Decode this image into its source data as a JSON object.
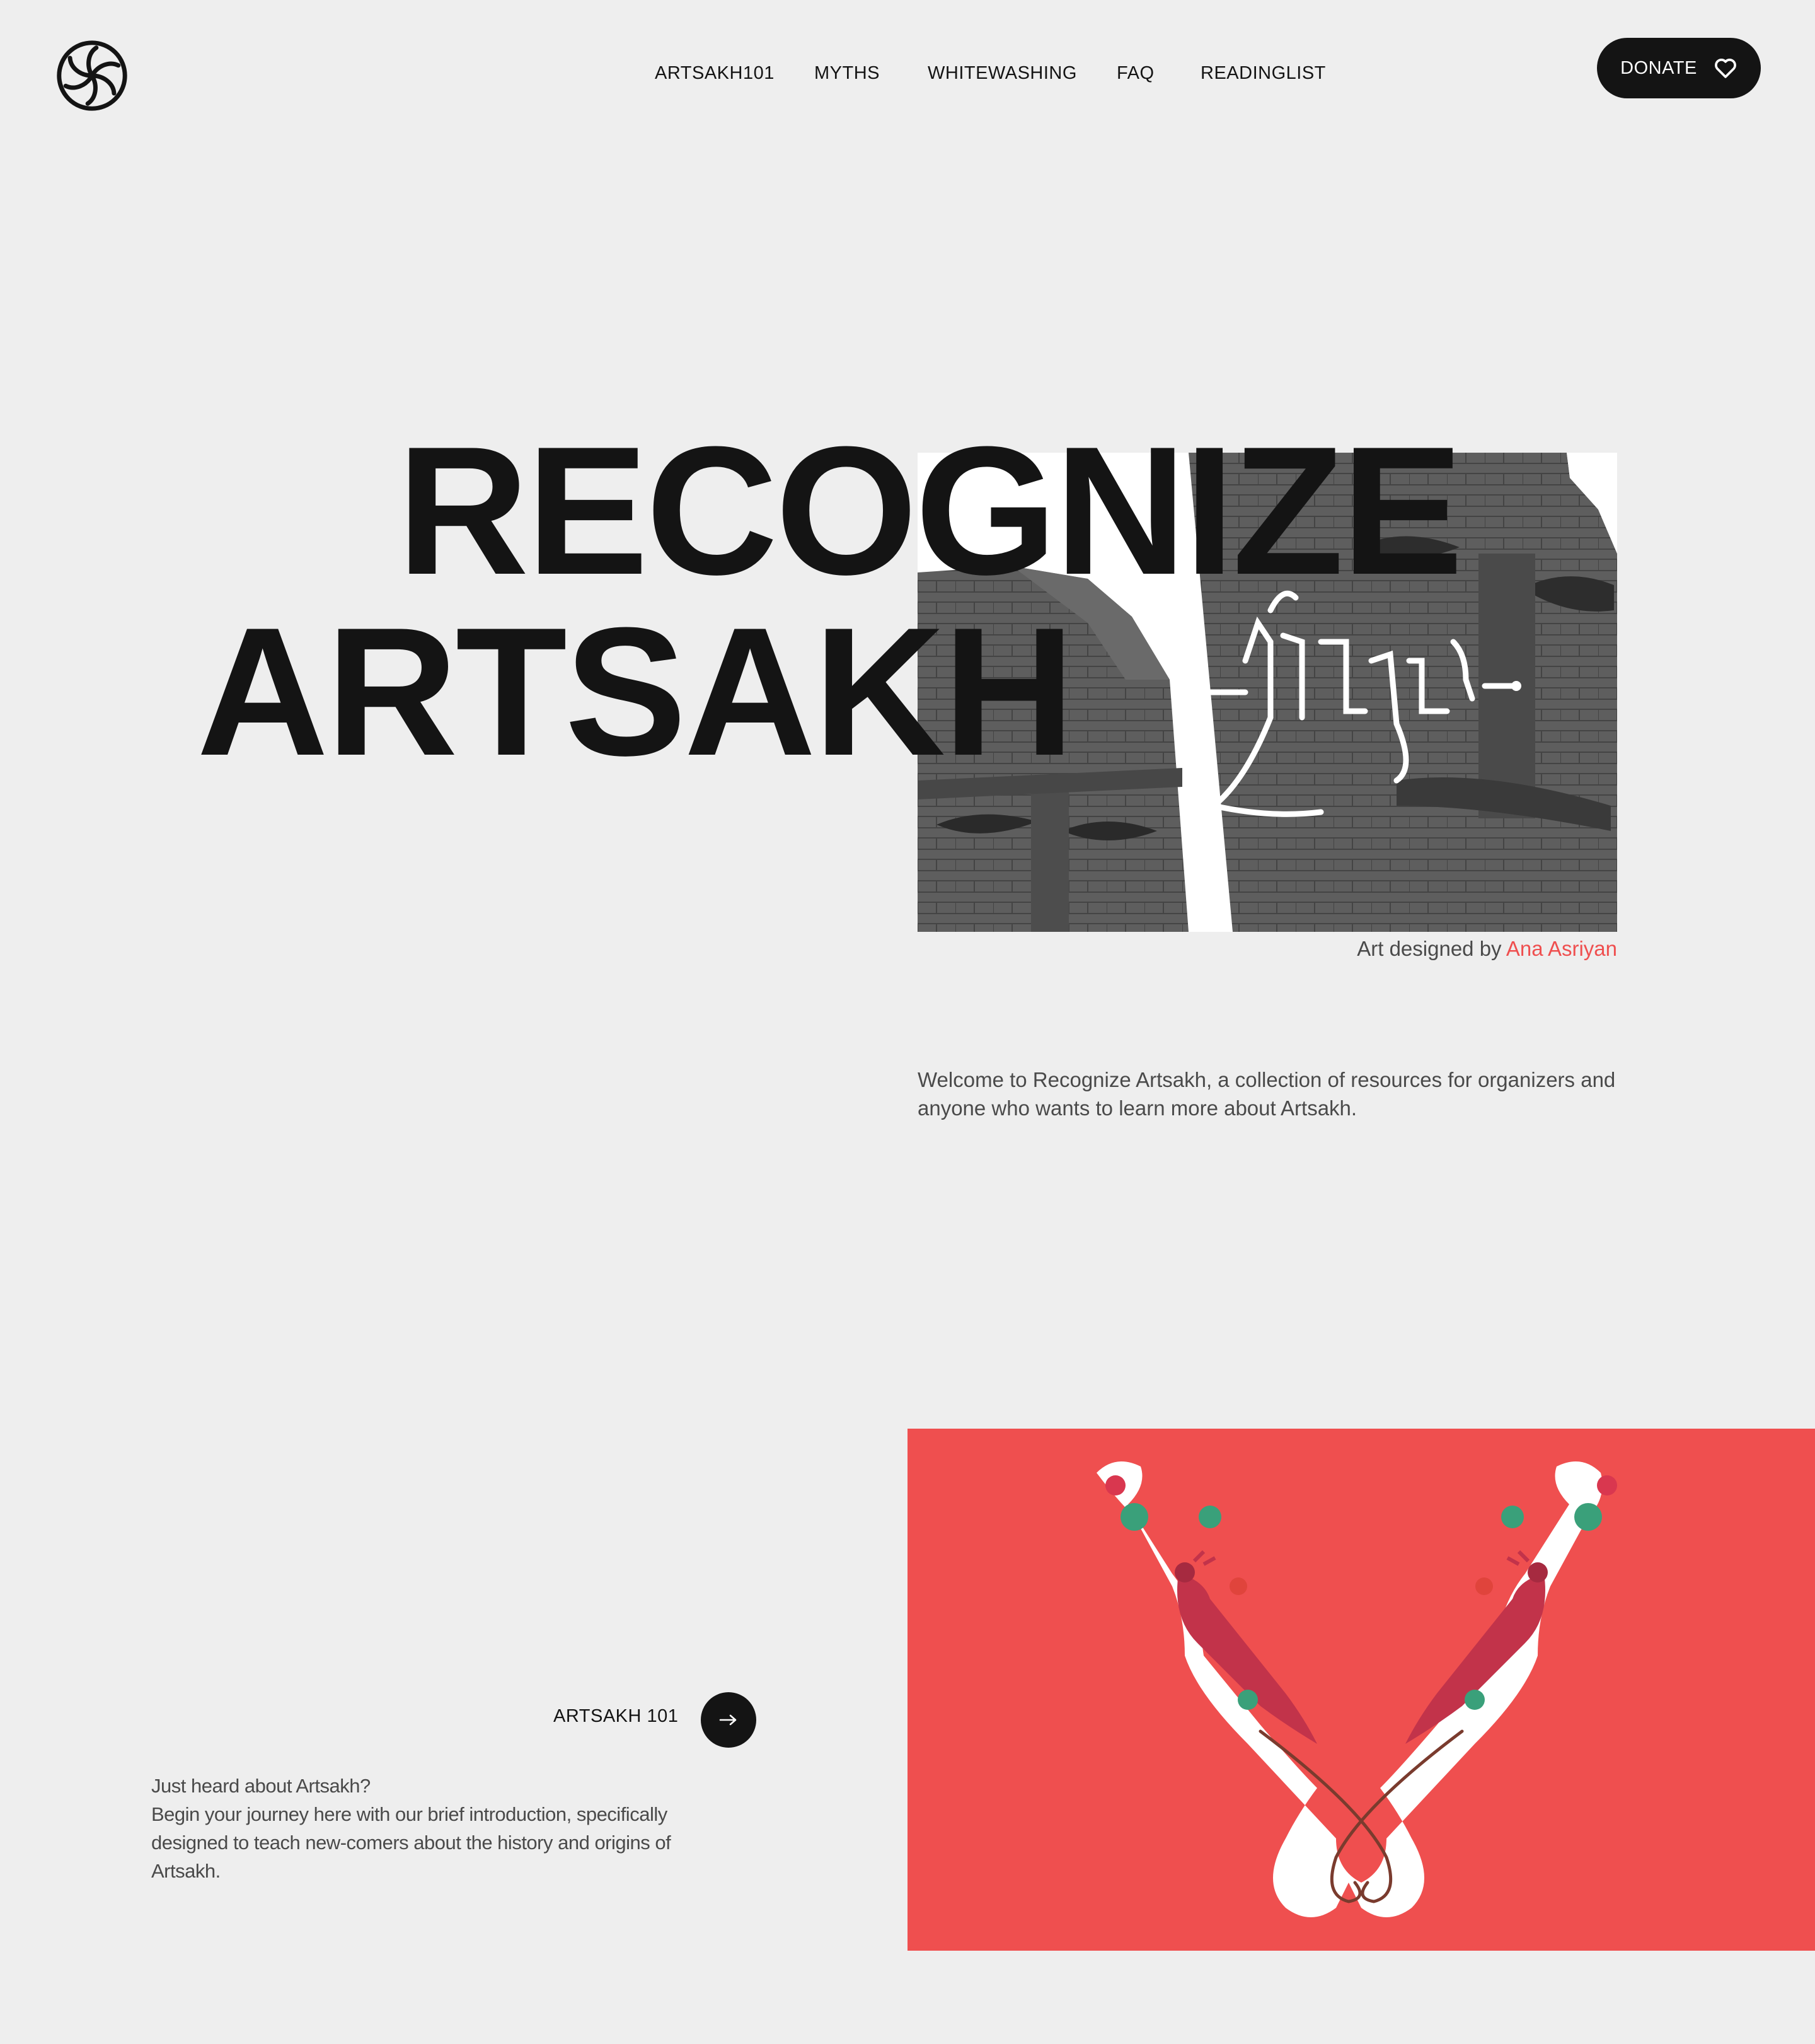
{
  "nav": {
    "items": [
      {
        "label": "ARTSAKH101"
      },
      {
        "label": "MYTHS"
      },
      {
        "label": "WHITEWASHING"
      },
      {
        "label": "FAQ"
      },
      {
        "label": "READINGLIST"
      }
    ],
    "donate_label": "DONATE",
    "logo_icon": "eternity-symbol-icon",
    "donate_icon": "heart-icon"
  },
  "hero": {
    "title_line1": "RECOGNIZE",
    "title_line2": "ARTSAKH",
    "credit_prefix": "Art designed by ",
    "credit_name": "Ana Asriyan",
    "welcome": "Welcome to Recognize Artsakh, a collection of resources for organizers and anyone who wants to learn more about Artsakh."
  },
  "section": {
    "cta_label": "ARTSAKH 101",
    "cta_icon": "arrow-right-icon",
    "intro_line1": "Just heard about Artsakh?",
    "intro_line2": "Begin your journey here with our brief introduction, specifically designed to teach new-comers about the history and origins of Artsakh."
  },
  "colors": {
    "background": "#eeeeee",
    "text": "#141414",
    "accent": "#ef4f4f",
    "muted_text": "#4a4a4a"
  }
}
